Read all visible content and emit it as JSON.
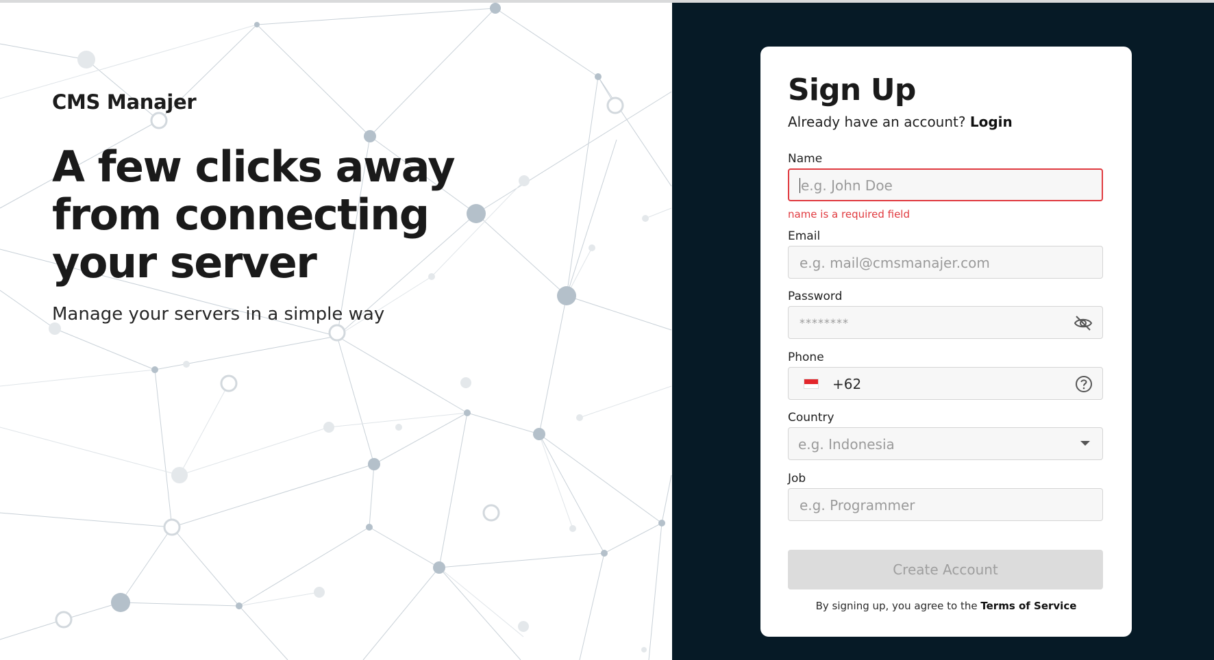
{
  "brand": {
    "name": "CMS Manajer"
  },
  "hero": {
    "headline": "A few clicks away from connecting your server",
    "tagline": "Manage your servers in a simple way"
  },
  "form": {
    "title": "Sign Up",
    "login_prompt": "Already have an account?",
    "login_link": "Login",
    "fields": {
      "name": {
        "label": "Name",
        "placeholder": "e.g. John Doe",
        "error": "name is a required field"
      },
      "email": {
        "label": "Email",
        "placeholder": "e.g. mail@cmsmanajer.com"
      },
      "password": {
        "label": "Password",
        "placeholder": "********"
      },
      "phone": {
        "label": "Phone",
        "dial_code": "+62"
      },
      "country": {
        "label": "Country",
        "placeholder": "e.g. Indonesia"
      },
      "job": {
        "label": "Job",
        "placeholder": "e.g. Programmer"
      }
    },
    "submit_label": "Create Account",
    "terms_prefix": "By signing up, you agree to the",
    "terms_link": "Terms of Service"
  },
  "icons": {
    "password_toggle": "eye-off-icon",
    "phone_help": "question-circle-icon",
    "country_dropdown": "chevron-down-icon",
    "phone_flag": "indonesia-flag-icon"
  },
  "colors": {
    "dark_panel": "#061a26",
    "error": "#e0393e",
    "button_disabled": "#dcdcdc"
  }
}
